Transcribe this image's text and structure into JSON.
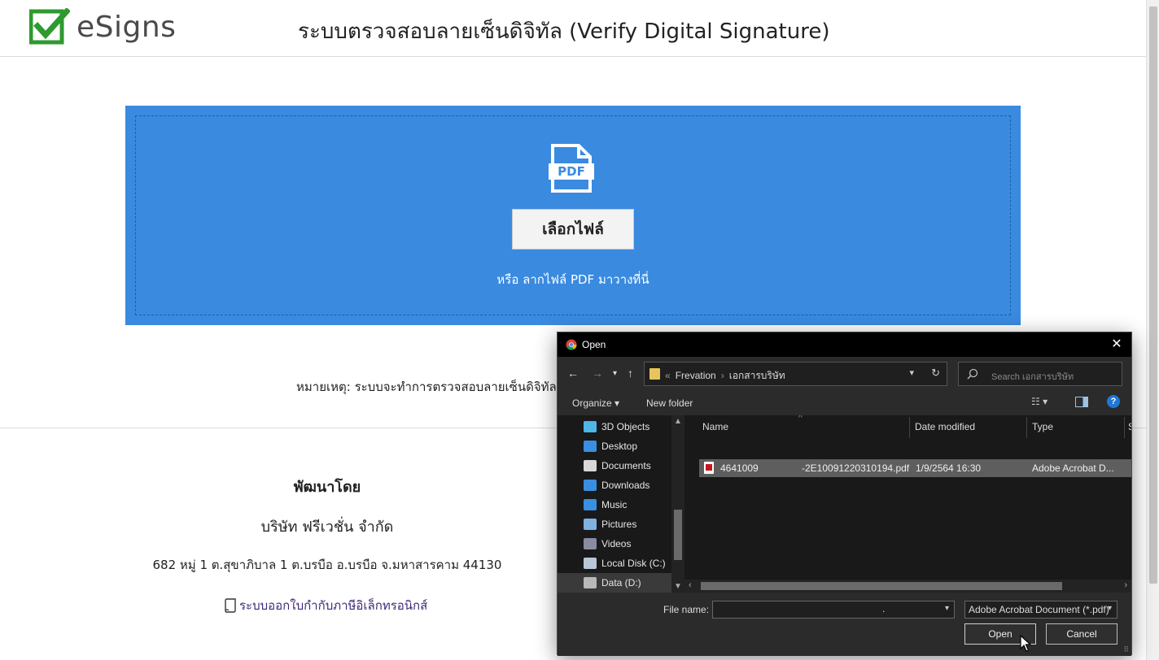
{
  "header": {
    "brand": "eSigns",
    "title": "ระบบตรวจสอบลายเซ็นดิจิทัล (Verify Digital Signature)"
  },
  "upload": {
    "icon": "pdf-file-icon",
    "choose_button": "เลือกไฟล์",
    "drop_hint": "หรือ ลากไฟล์ PDF มาวางที่นี่"
  },
  "note": "หมายเหตุ: ระบบจะทำการตรวจสอบลายเซ็นดิจิทัล",
  "footer": {
    "developed_by": "พัฒนาโดย",
    "company": "บริษัท ฟรีเวชั่น จำกัด",
    "address": "682 หมู่ 1 ต.สุขาภิบาล 1 ต.บรบือ อ.บรบือ จ.มหาสารคาม 44130",
    "link": "ระบบออกใบกำกับภาษีอิเล็กทรอนิกส์"
  },
  "dialog": {
    "title": "Open",
    "close": "✕",
    "address": {
      "prefix": "«",
      "crumbs": [
        "Frevation",
        "เอกสารบริษัท"
      ]
    },
    "search_placeholder": "Search เอกสารบริษัท",
    "toolbar": {
      "organize": "Organize ▾",
      "new_folder": "New folder",
      "help": "?"
    },
    "nav_items": [
      {
        "label": "3D Objects",
        "icon": "3d-objects-icon",
        "color": "#4fb6e8"
      },
      {
        "label": "Desktop",
        "icon": "desktop-icon",
        "color": "#3a8fe0"
      },
      {
        "label": "Documents",
        "icon": "documents-icon",
        "color": "#d8d8d8"
      },
      {
        "label": "Downloads",
        "icon": "downloads-icon",
        "color": "#3a8fe0"
      },
      {
        "label": "Music",
        "icon": "music-icon",
        "color": "#3a8fe0"
      },
      {
        "label": "Pictures",
        "icon": "pictures-icon",
        "color": "#7fb2e0"
      },
      {
        "label": "Videos",
        "icon": "videos-icon",
        "color": "#8a8aa0"
      },
      {
        "label": "Local Disk (C:)",
        "icon": "local-disk-icon",
        "color": "#b8c8d8"
      },
      {
        "label": "Data (D:)",
        "icon": "drive-icon",
        "color": "#b8b8b8"
      }
    ],
    "columns": [
      "Name",
      "Date modified",
      "Type",
      "S"
    ],
    "files": [
      {
        "name_left": "4641009",
        "name_right": "-2E10091220310194.pdf",
        "date": "1/9/2564 16:30",
        "type": "Adobe Acrobat D..."
      }
    ],
    "file_name_label": "File name:",
    "file_name_value": ".",
    "filter": "Adobe Acrobat Document (*.pdf)",
    "open_button": "Open",
    "cancel_button": "Cancel"
  },
  "colors": {
    "dropzone": "#3a8ae0",
    "brand_check": "#2e9a2e",
    "dialog_bg": "#2b2b2b"
  }
}
